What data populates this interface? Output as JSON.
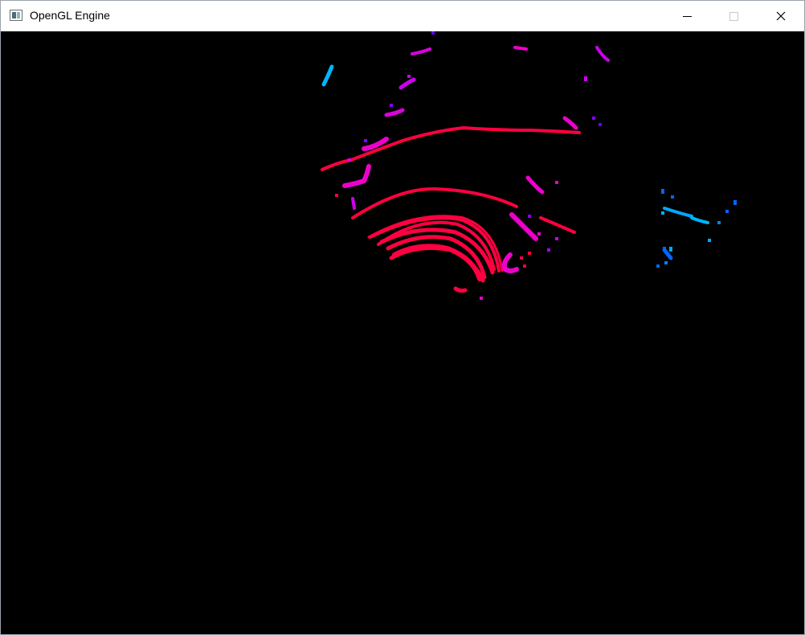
{
  "window": {
    "title": "OpenGL Engine",
    "icons": {
      "app": "app-window-icon",
      "minimize": "minimize-icon",
      "maximize": "maximize-icon",
      "close": "close-icon"
    }
  },
  "viewport": {
    "background": "#000000",
    "palette": {
      "near": "#ff0040",
      "mid": "#ee00cc",
      "far": "#8800ff",
      "cyan": "#00b4ff",
      "blue": "#0066ff"
    }
  }
}
